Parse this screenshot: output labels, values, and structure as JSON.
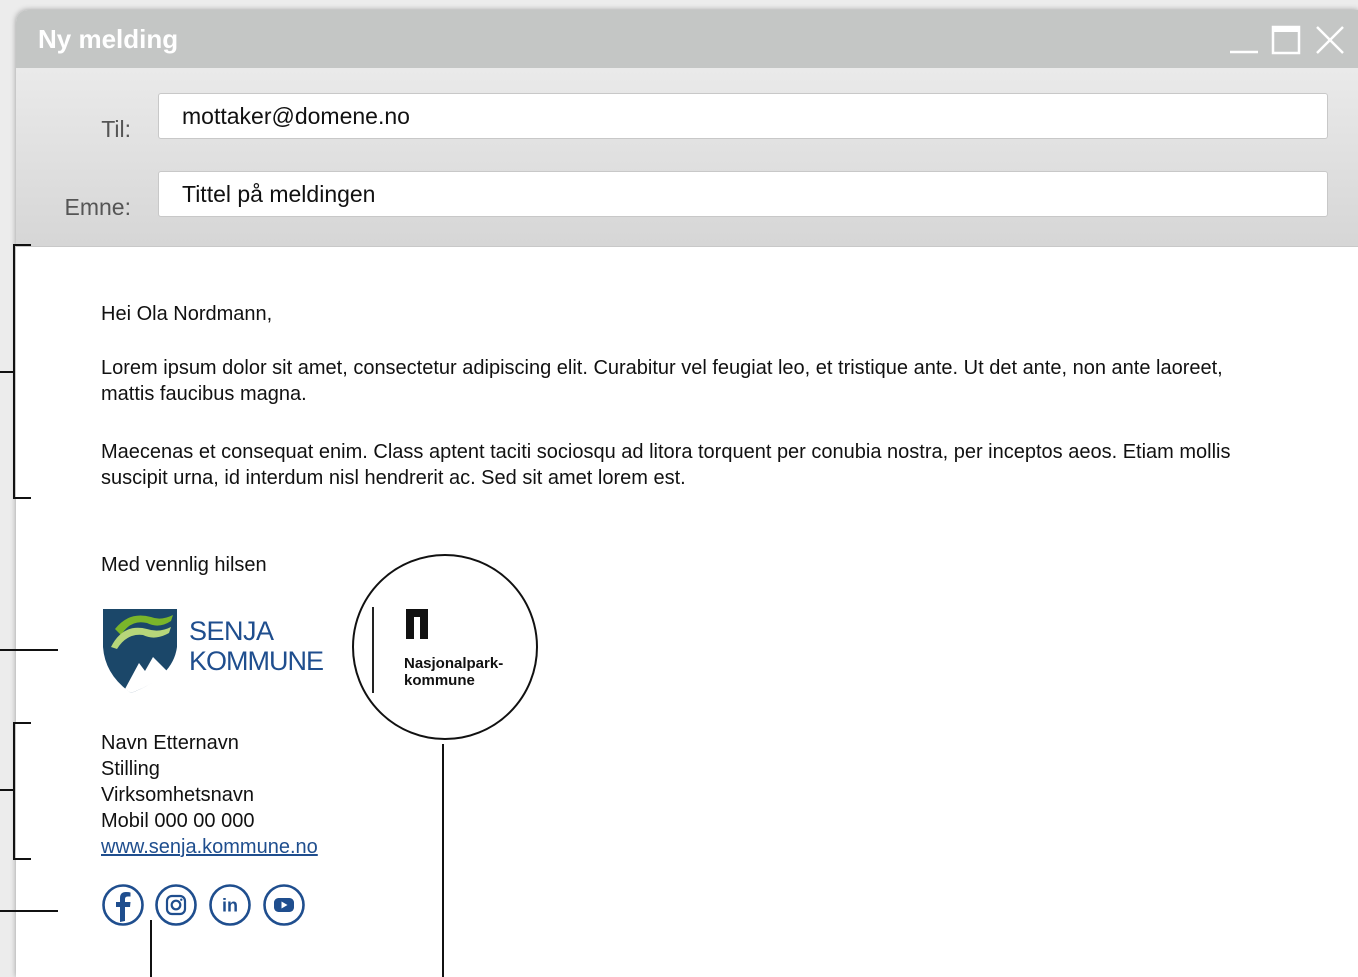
{
  "window": {
    "title": "Ny melding",
    "controls": [
      "minimize-icon",
      "maximize-icon",
      "close-icon"
    ]
  },
  "fields": {
    "to_label": "Til:",
    "to_value": "mottaker@domene.no",
    "subject_label": "Emne:",
    "subject_value": "Tittel på meldingen"
  },
  "message": {
    "greeting": "Hei Ola Nordmann,",
    "paragraph1": "Lorem ipsum dolor sit amet, consectetur adipiscing elit. Curabitur vel feugiat leo, et tristique ante. Ut det ante, non ante laoreet, mattis faucibus magna.",
    "paragraph2": "Maecenas et consequat enim. Class aptent taciti sociosqu ad litora torquent per conubia nostra, per inceptos aeos. Etiam mollis suscipit urna, id interdum nisl hendrerit ac. Sed sit amet lorem est.",
    "closing": "Med vennlig hilsen"
  },
  "logos": {
    "senja_line1": "SENJA",
    "senja_line2": "KOMMUNE",
    "np_line1": "Nasjonalpark-",
    "np_line2": "kommune"
  },
  "signature": {
    "name": "Navn Etternavn",
    "position": "Stilling",
    "organization": "Virksomhetsnavn",
    "phone": "Mobil 000 00 000",
    "website": "www.senja.kommune.no"
  },
  "social": [
    "facebook-icon",
    "instagram-icon",
    "linkedin-icon",
    "youtube-icon"
  ],
  "colors": {
    "titlebar": "#c4c6c5",
    "brand_blue": "#1f4e8e",
    "brand_navy": "#1b4769",
    "brand_green": "#7ab52a",
    "link": "#1f4e8e"
  }
}
